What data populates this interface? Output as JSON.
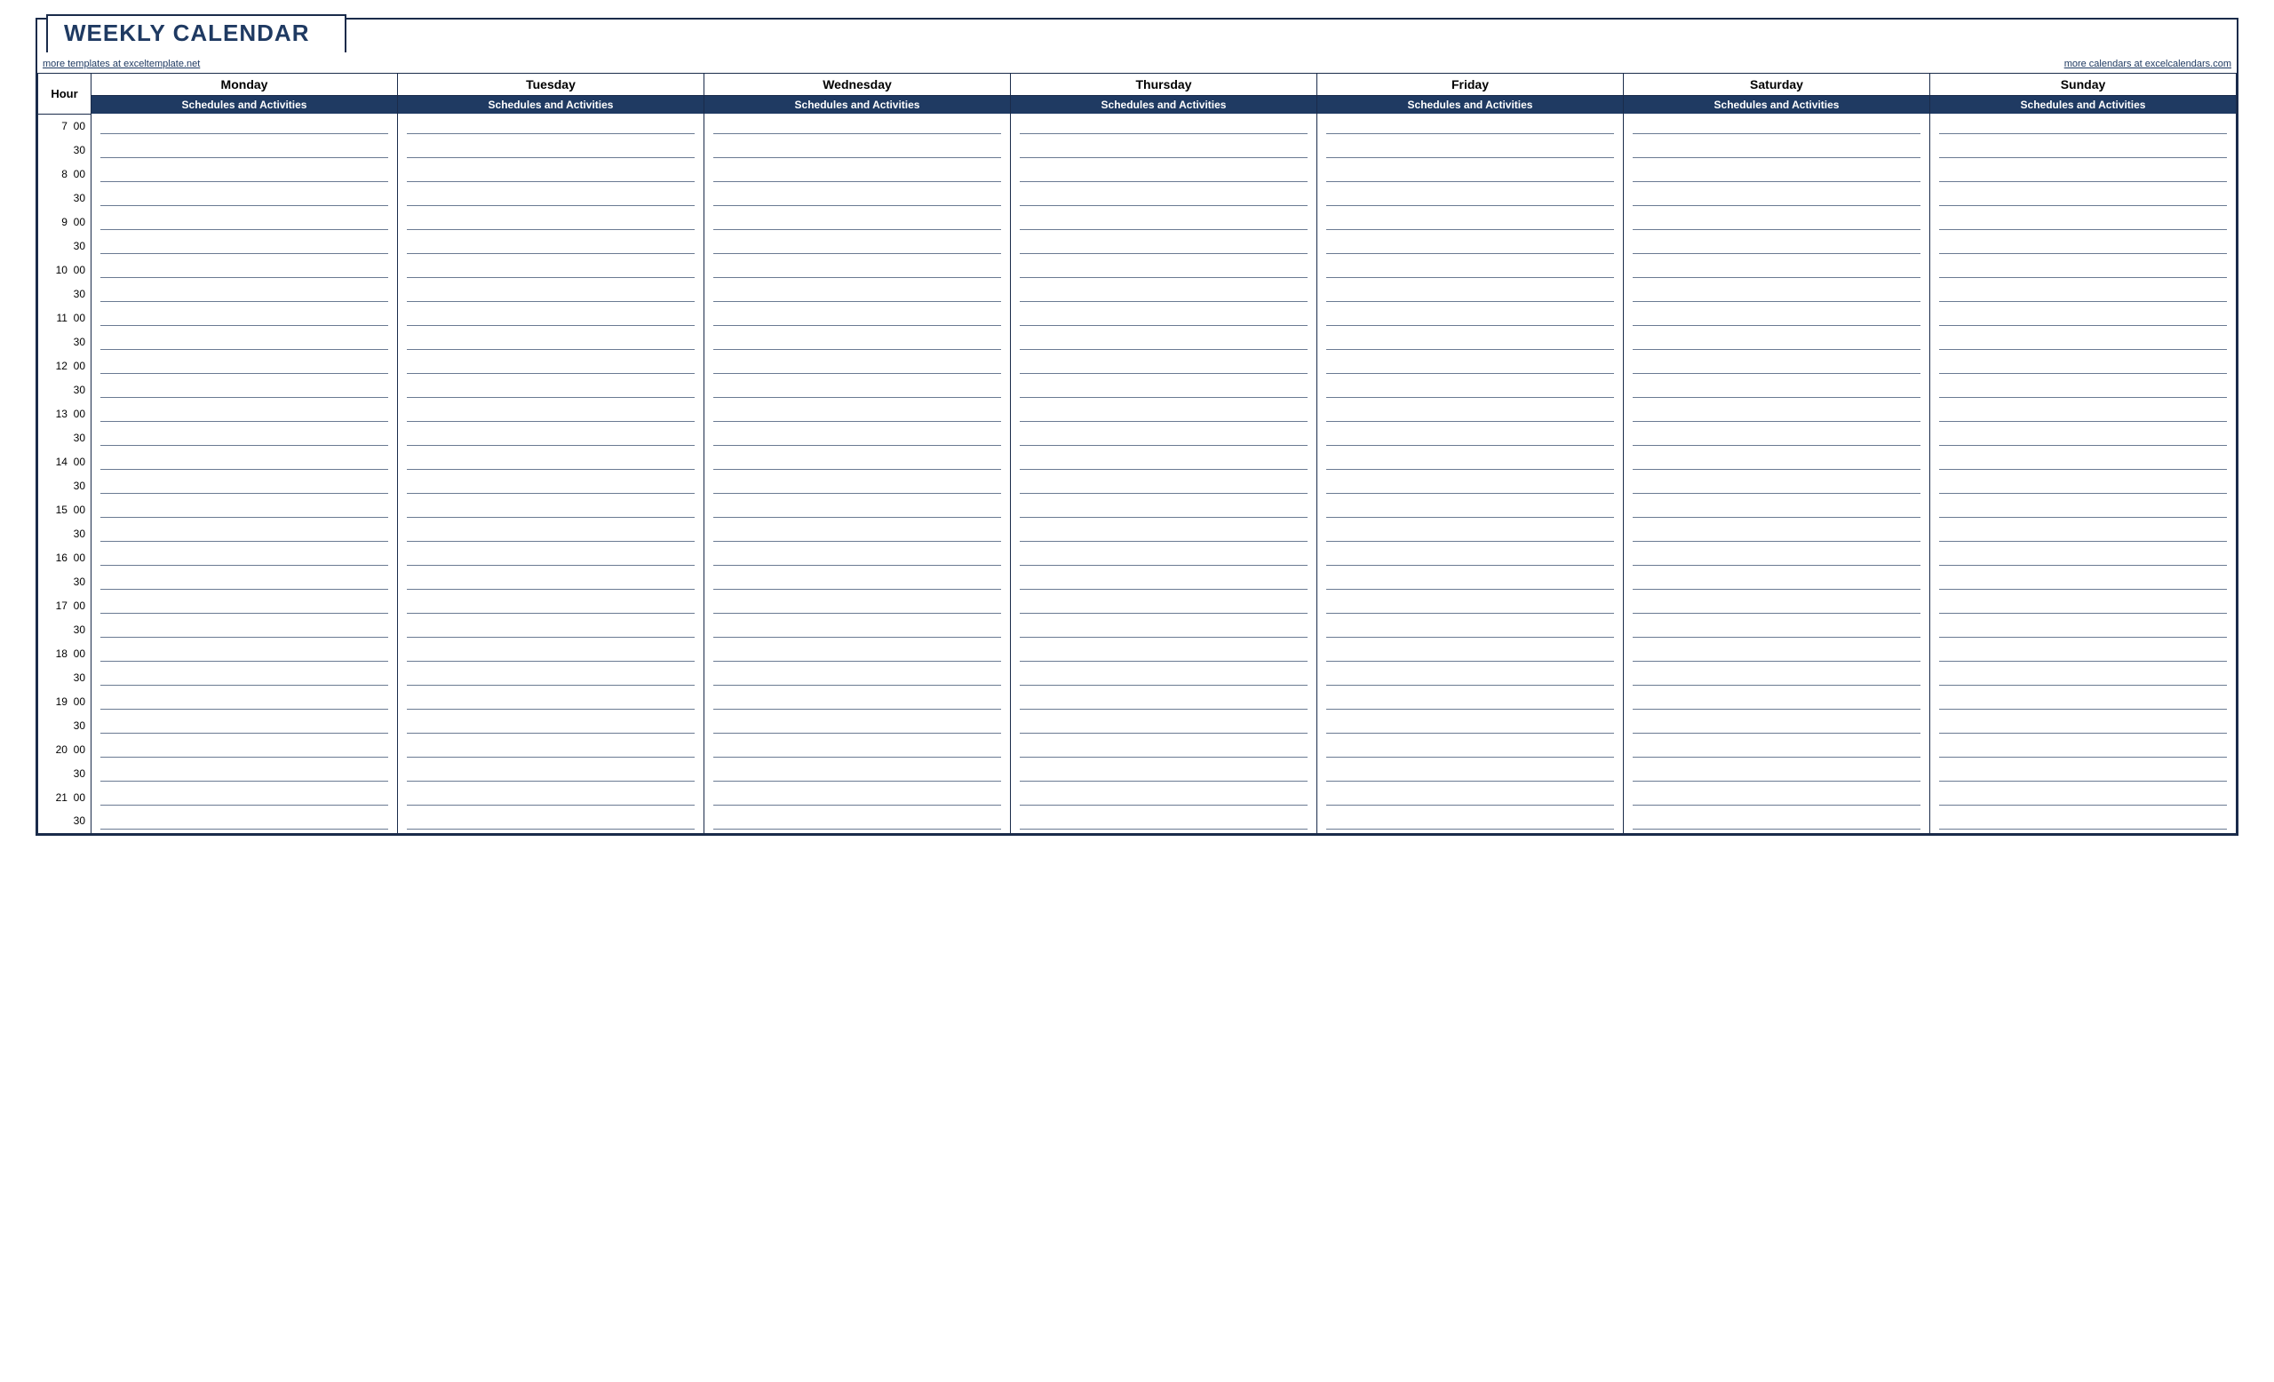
{
  "title": "WEEKLY CALENDAR",
  "links": {
    "left": "more templates at exceltemplate.net",
    "right": "more calendars at excelcalendars.com"
  },
  "hour_header": "Hour",
  "sub_header": "Schedules and Activities",
  "days": [
    "Monday",
    "Tuesday",
    "Wednesday",
    "Thursday",
    "Friday",
    "Saturday",
    "Sunday"
  ],
  "hours": [
    7,
    8,
    9,
    10,
    11,
    12,
    13,
    14,
    15,
    16,
    17,
    18,
    19,
    20,
    21
  ],
  "minute_labels": [
    "00",
    "30"
  ]
}
